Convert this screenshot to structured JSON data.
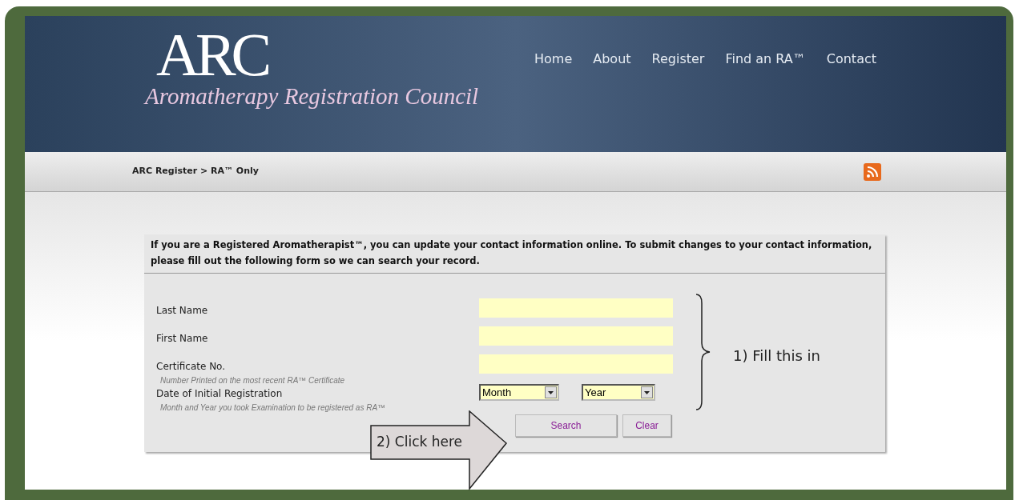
{
  "header": {
    "logo_mark": "ARC",
    "logo_name": "Aromatherapy Registration Council",
    "nav": [
      "Home",
      "About",
      "Register",
      "Find an RA™",
      "Contact"
    ]
  },
  "breadcrumb": "ARC Register > RA™ Only",
  "form": {
    "intro": "If you are a Registered Aromatherapist™, you can update your contact information online. To submit changes to your contact information, please fill out the following form so we can search your record.",
    "fields": [
      {
        "kind": "text",
        "label": "Last Name"
      },
      {
        "kind": "text",
        "label": "First Name"
      },
      {
        "kind": "text",
        "label": "Certificate No.",
        "hint": "Number Printed on the most recent RA™ Certificate"
      },
      {
        "kind": "date",
        "label": "Date of Initial Registration",
        "hint": "Month and Year you took Examination to be registered as RA™",
        "selects": [
          "Month",
          "Year"
        ]
      }
    ],
    "buttons": [
      "Search",
      "Clear"
    ]
  },
  "annotations": [
    {
      "kind": "brace",
      "text": "1) Fill this in"
    },
    {
      "kind": "arrow",
      "text": "2) Click here"
    }
  ]
}
